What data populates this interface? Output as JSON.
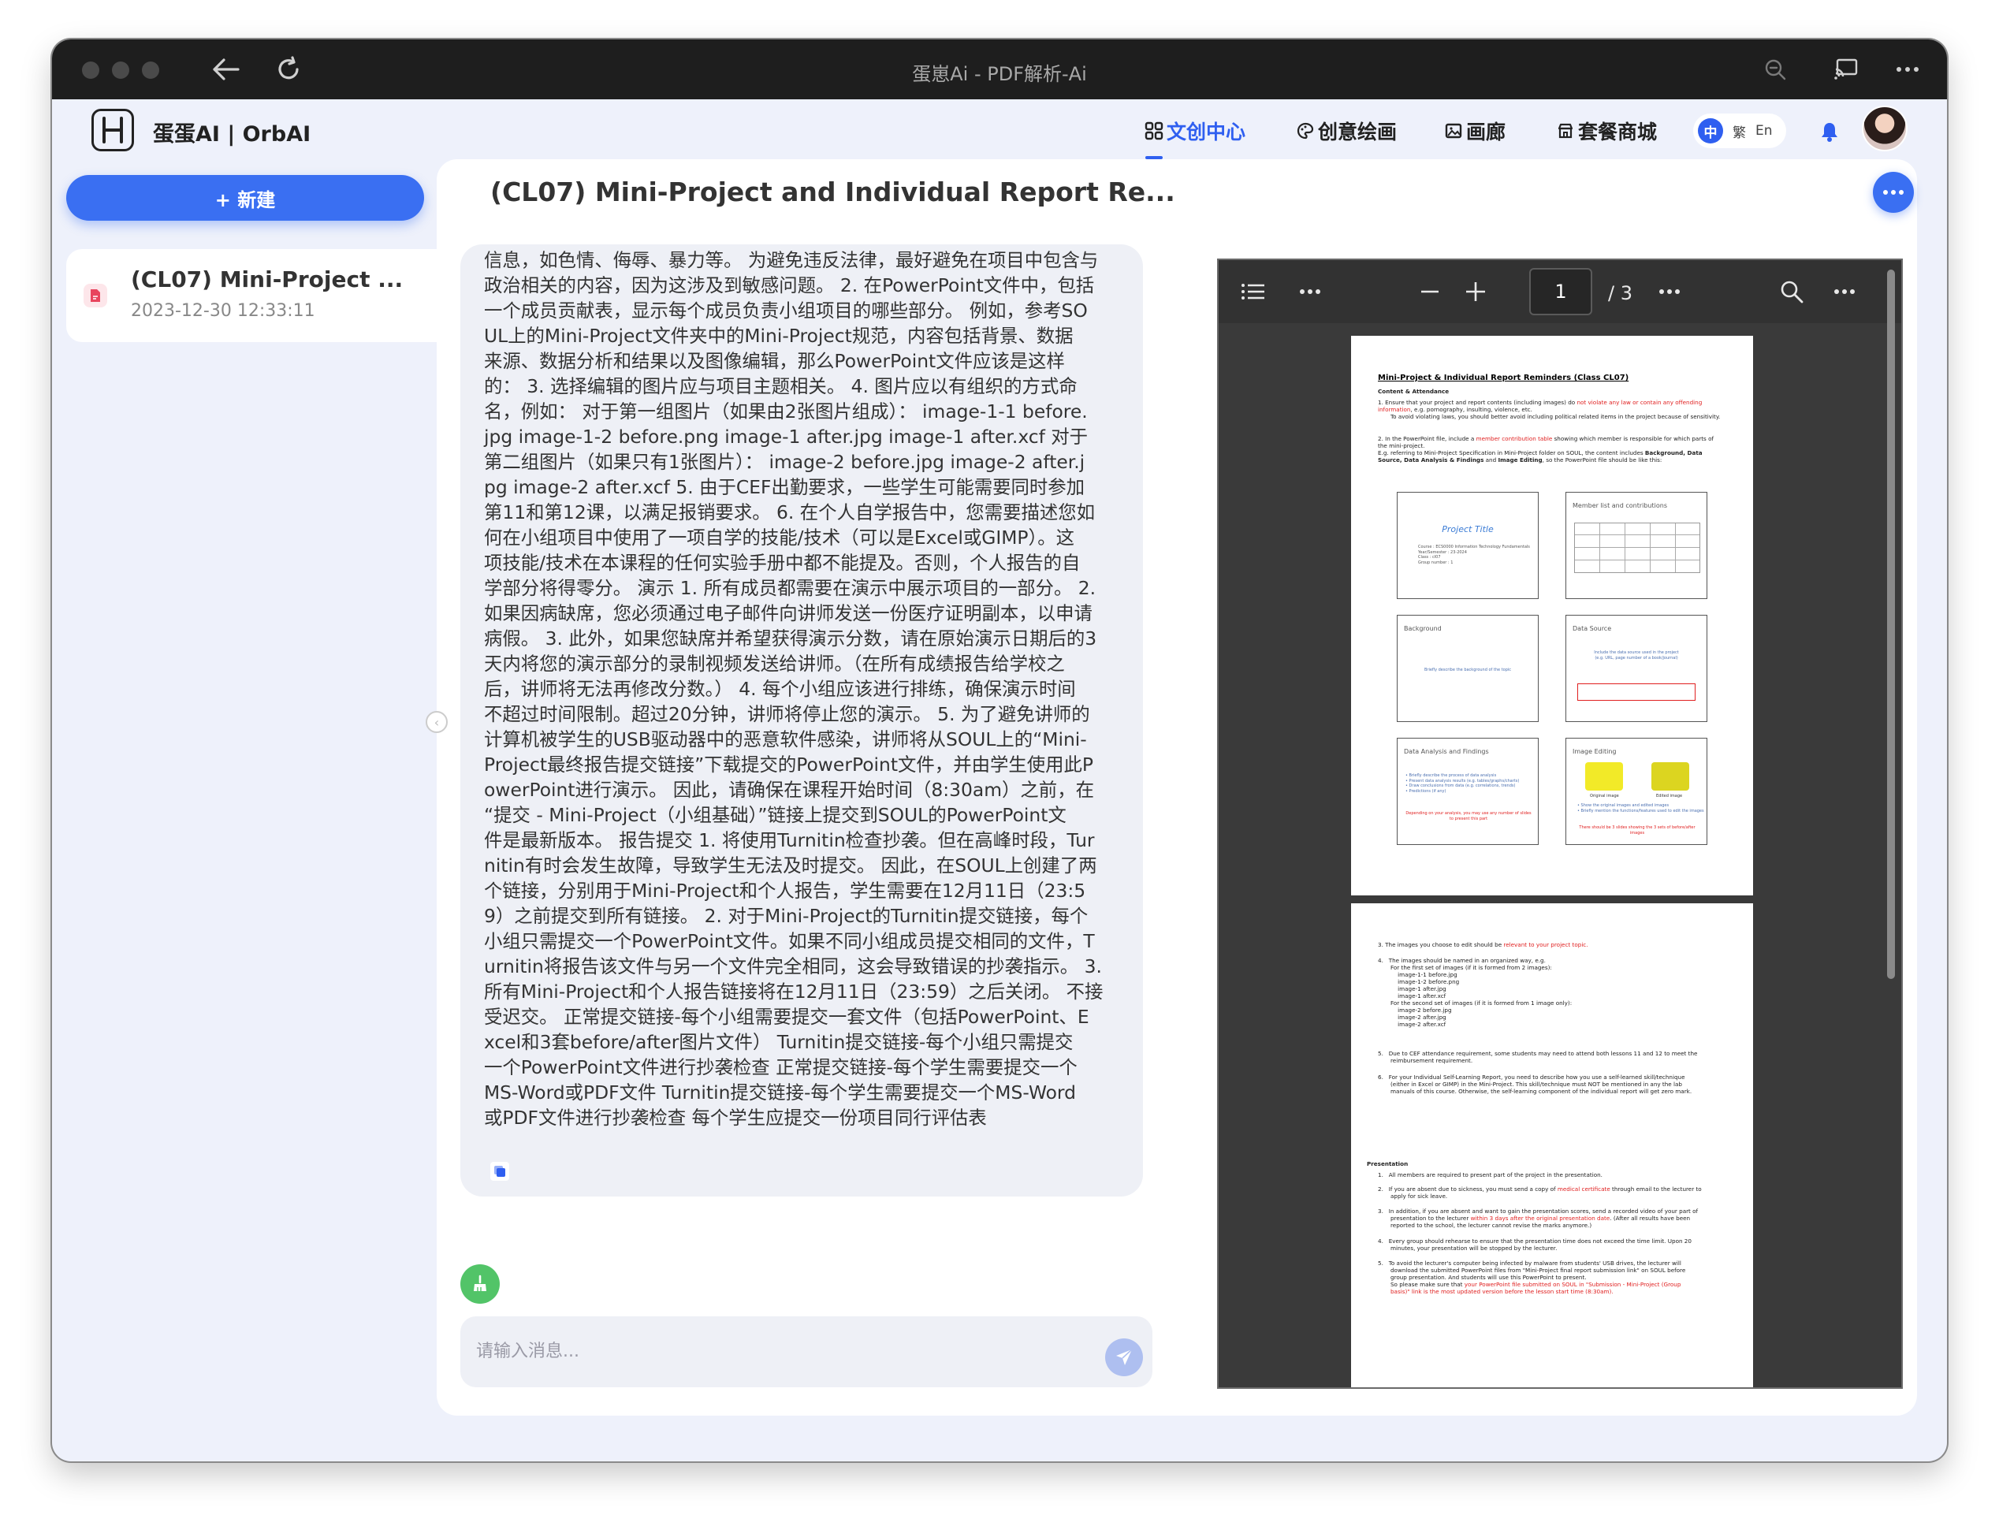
{
  "window": {
    "title": "蛋崽Ai - PDF解析-Ai"
  },
  "header": {
    "brand": "蛋蛋AI | OrbAI",
    "nav": [
      {
        "label": "文创中心",
        "icon": "grid-icon",
        "active": true
      },
      {
        "label": "创意绘画",
        "icon": "palette-icon",
        "active": false
      },
      {
        "label": "画廊",
        "icon": "gallery-icon",
        "active": false
      },
      {
        "label": "套餐商城",
        "icon": "shop-icon",
        "active": false
      }
    ],
    "lang": {
      "zh": "中",
      "tw": "繁",
      "en": "En"
    }
  },
  "sidebar": {
    "new_button": "+ 新建",
    "documents": [
      {
        "title": "(CL07) Mini-Project ...",
        "date": "2023-12-30 12:33:11"
      }
    ]
  },
  "main": {
    "title": "(CL07) Mini-Project and Individual Report Re...",
    "message": "信息，如色情、侮辱、暴力等。 为避免违反法律，最好避免在项目中包含与\n政治相关的内容，因为这涉及到敏感问题。 2. 在PowerPoint文件中，包括\n一个成员贡献表，显示每个成员负责小组项目的哪些部分。 例如，参考SO\nUL上的Mini-Project文件夹中的Mini-Project规范，内容包括背景、数据\n来源、数据分析和结果以及图像编辑，那么PowerPoint文件应该是这样\n的： 3. 选择编辑的图片应与项目主题相关。 4. 图片应以有组织的方式命\n名，例如： 对于第一组图片（如果由2张图片组成）： image-1-1 before.\njpg image-1-2 before.png image-1 after.jpg image-1 after.xcf 对于\n第二组图片（如果只有1张图片）： image-2 before.jpg image-2 after.j\npg image-2 after.xcf 5. 由于CEF出勤要求，一些学生可能需要同时参加\n第11和第12课，以满足报销要求。 6. 在个人自学报告中，您需要描述您如\n何在小组项目中使用了一项自学的技能/技术（可以是Excel或GIMP）。这\n项技能/技术在本课程的任何实验手册中都不能提及。否则，个人报告的自\n学部分将得零分。 演示 1. 所有成员都需要在演示中展示项目的一部分。 2.\n如果因病缺席，您必须通过电子邮件向讲师发送一份医疗证明副本，以申请\n病假。 3. 此外，如果您缺席并希望获得演示分数，请在原始演示日期后的3\n天内将您的演示部分的录制视频发送给讲师。（在所有成绩报告给学校之\n后，讲师将无法再修改分数。） 4. 每个小组应该进行排练，确保演示时间\n不超过时间限制。超过20分钟，讲师将停止您的演示。 5. 为了避免讲师的\n计算机被学生的USB驱动器中的恶意软件感染，讲师将从SOUL上的“Mini-\nProject最终报告提交链接”下载提交的PowerPoint文件，并由学生使用此P\nowerPoint进行演示。 因此，请确保在课程开始时间（8:30am）之前，在\n“提交 - Mini-Project（小组基础）”链接上提交到SOUL的PowerPoint文\n件是最新版本。 报告提交 1. 将使用Turnitin检查抄袭。但在高峰时段，Tur\nnitin有时会发生故障，导致学生无法及时提交。 因此，在SOUL上创建了两\n个链接，分别用于Mini-Project和个人报告，学生需要在12月11日（23:5\n9）之前提交到所有链接。 2. 对于Mini-Project的Turnitin提交链接，每个\n小组只需提交一个PowerPoint文件。如果不同小组成员提交相同的文件，T\nurnitin将报告该文件与另一个文件完全相同，这会导致错误的抄袭指示。 3.\n所有Mini-Project和个人报告链接将在12月11日（23:59）之后关闭。 不接\n受迟交。 正常提交链接-每个小组需要提交一套文件（包括PowerPoint、E\nxcel和3套before/after图片文件） Turnitin提交链接-每个小组只需提交\n一个PowerPoint文件进行抄袭检查 正常提交链接-每个学生需要提交一个\nMS-Word或PDF文件 Turnitin提交链接-每个学生需要提交一个MS-Word\n或PDF文件进行抄袭检查 每个学生应提交一份项目同行评估表",
    "input_placeholder": "请输入消息..."
  },
  "pdf": {
    "current_page": "1",
    "total_pages": "/ 3",
    "page1": {
      "heading": "Mini-Project & Individual Report Reminders (Class CL07)",
      "section": "Content & Attendance",
      "item1_a": "1.   Ensure that your project and report contents (including images) do ",
      "item1_red": "not violate any law or contain any offending information",
      "item1_b": ", e.g. pornography, insulting, violence, etc.",
      "item1_c": "To avoid violating laws, you should better avoid including political related items in the project because of sensitivity.",
      "item2_a": "2.   In the PowerPoint file, include a ",
      "item2_red": "member contribution table",
      "item2_b": " showing which member is responsible for which parts of the mini-project.",
      "item2_c": "E.g. referring to Mini-Project Specification in Mini-Project folder on SOUL, the content includes ",
      "item2_bold": "Background, Data Source, Data Analysis & Findings",
      "item2_d": " and ",
      "item2_bold2": "Image Editing",
      "item2_e": ", so the PowerPoint file should be like this:",
      "slides": {
        "project_title": "Project Title",
        "project_meta": "Course : ECS0000 Information Technology Fundamentals\nYear/Semester : 23-2024\nClass : cl07\nGroup number : 1",
        "member_list": "Member list and contributions",
        "background": "Background",
        "background_desc": "Briefly describe the background of the topic",
        "data_source": "Data Source",
        "data_source_desc": "Include the data source used in the project\n(e.g. URL, page number of a book/journal)",
        "analysis": "Data Analysis and Findings",
        "analysis_desc": "• Briefly describe the process of data analysis\n• Present data analysis results (e.g. tables/graphs/charts)\n• Draw conclusions from data (e.g. correlations, trends)\n• Predictions (if any)",
        "analysis_red": "Depending on your analysis, you may use any number of slides to present this part",
        "image_editing": "Image Editing",
        "original_image": "Original image",
        "edited_image": "Edited image",
        "image_desc": "• Show the original images and edited images\n• Briefly mention the functions/features used to edit the images",
        "image_red": "There should be 3 slides showing the 3 sets of before/after images"
      }
    },
    "page2": {
      "i3_a": "3.   The images you choose to edit should be ",
      "i3_red": "relevant to your project topic.",
      "i4": "4.   The images should be named in an organized way, e.g.\n       For the first set of images (if it is formed from 2 images):\n           image-1-1 before.jpg\n           image-1-2 before.png\n           image-1 after.jpg\n           image-1 after.xcf\n       For the second set of images (if it is formed from 1 image only):\n           image-2 before.jpg\n           image-2 after.jpg\n           image-2 after.xcf",
      "i5": "5.   Due to CEF attendance requirement, some students may need to attend both lessons 11 and 12 to meet the\n       reimbursement requirement.",
      "i6": "6.   For your Individual Self-Learning Report, you need to describe how you use a self-learned skill/technique\n       (either in Excel or GIMP) in the Mini-Project. This skill/technique must NOT be mentioned in any the lab\n       manuals of this course. Otherwise, the self-learning component of the individual report will get zero mark.",
      "presentation": "Presentation",
      "p1": "1.   All members are required to present part of the project in the presentation.",
      "p2_a": "2.   If you are absent due to sickness, you must send a copy of ",
      "p2_red": "medical certificate",
      "p2_b": " through email to the lecturer to\n       apply for sick leave.",
      "p3_a": "3.   In addition, if you are absent and want to gain the presentation scores, send a recorded video of your part of\n       presentation to the lecturer ",
      "p3_red": "within 3 days after the original presentation date",
      "p3_b": ". (After all results have been\n       reported to the school, the lecturer cannot revise the marks anymore.)",
      "p4": "4.   Every group should rehearse to ensure that the presentation time does not exceed the time limit. Upon 20\n       minutes, your presentation will be stopped by the lecturer.",
      "p5_a": "5.   To avoid the lecturer's computer being infected by malware from students' USB drives, the lecturer will\n       download the submitted PowerPoint files from \"Mini-Project final report submission link\" on SOUL before\n       group presentation. And students will use this PowerPoint to present.\n       So please make sure that ",
      "p5_red": "your PowerPoint file submitted on SOUL in \"Submission - Mini-Project (Group\n       basis)\" link is the most updated version before the lesson start time (8:30am)."
    }
  },
  "colors": {
    "accent": "#3a6ff2",
    "active_nav": "#2f5ff0",
    "send_button": "#aebff0",
    "broom_button": "#52c468",
    "doc_icon": "#e8455e"
  }
}
